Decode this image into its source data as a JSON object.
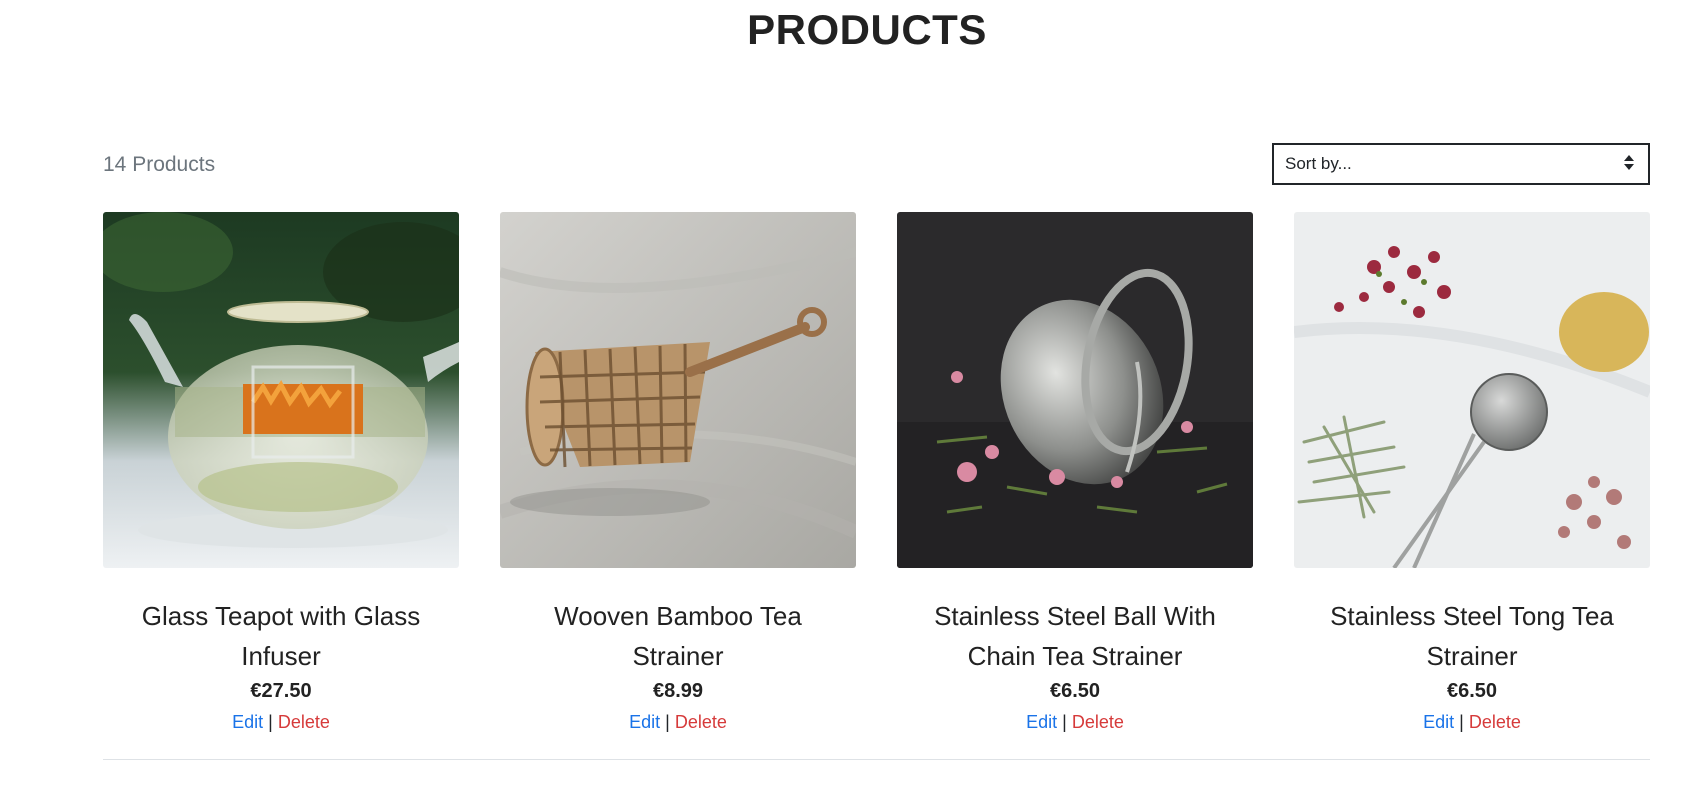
{
  "page": {
    "title": "PRODUCTS"
  },
  "toolbar": {
    "count_label": "14 Products",
    "sort": {
      "selected": "Sort by..."
    }
  },
  "products": [
    {
      "name": "Glass Teapot with Glass Infuser",
      "price": "€27.50",
      "edit_label": "Edit",
      "delete_label": "Delete",
      "image_icon": "glass-teapot-image"
    },
    {
      "name": "Wooven Bamboo Tea Strainer",
      "price": "€8.99",
      "edit_label": "Edit",
      "delete_label": "Delete",
      "image_icon": "bamboo-strainer-image"
    },
    {
      "name": "Stainless Steel Ball With Chain Tea Strainer",
      "price": "€6.50",
      "edit_label": "Edit",
      "delete_label": "Delete",
      "image_icon": "steel-ball-strainer-image"
    },
    {
      "name": "Stainless Steel Tong Tea Strainer",
      "price": "€6.50",
      "edit_label": "Edit",
      "delete_label": "Delete",
      "image_icon": "tong-strainer-image"
    }
  ],
  "actions_separator": "|",
  "colors": {
    "edit_link": "#1a73e8",
    "delete_link": "#d63a3a",
    "muted_text": "#6c757d"
  }
}
